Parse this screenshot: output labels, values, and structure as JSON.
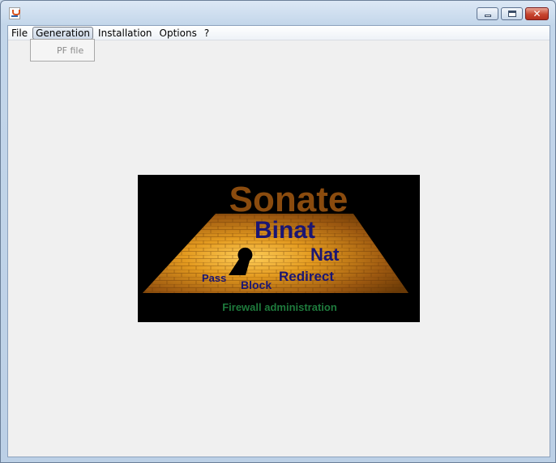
{
  "window": {
    "title": "",
    "controls": {
      "minimize": "minimize",
      "maximize": "maximize",
      "close": "✕"
    }
  },
  "menubar": {
    "items": [
      "File",
      "Generation",
      "Installation",
      "Options",
      "?"
    ],
    "active_index": 1
  },
  "dropdown": {
    "items": [
      "PF file"
    ]
  },
  "logo": {
    "title": "Sonate",
    "words": [
      "Binat",
      "Nat",
      "Redirect",
      "Pass",
      "Block"
    ],
    "caption": "Firewall administration"
  },
  "colors": {
    "logo_title": "#8a4b0e",
    "logo_words": "#1b1673",
    "logo_caption": "#1e7a3c",
    "floor_light": "#ffcf5a",
    "floor_dark": "#6a3a06"
  }
}
